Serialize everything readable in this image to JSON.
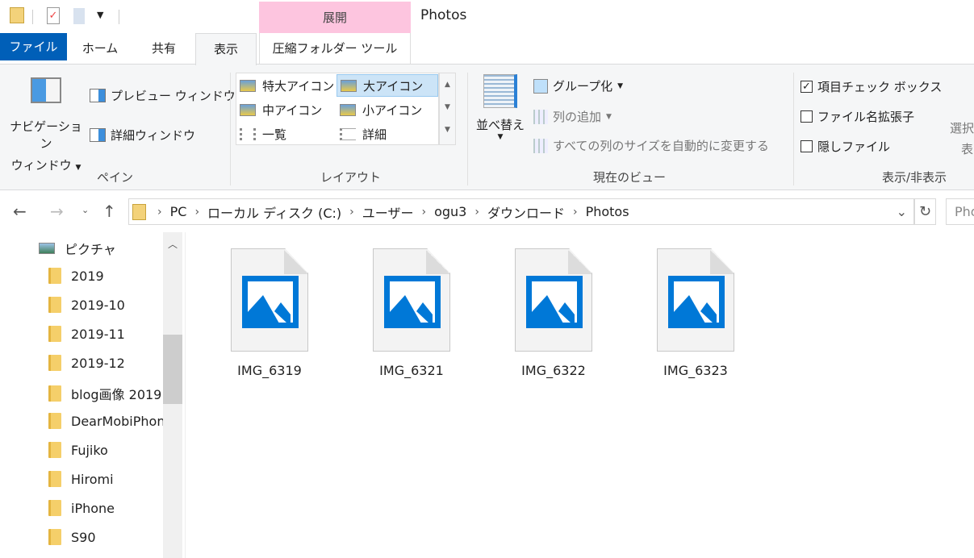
{
  "window": {
    "title": "Photos",
    "contextual_tab": "展開",
    "contextual_color": "#fdc5df"
  },
  "tabs": [
    {
      "label": "ファイル",
      "active_color": "#005fb8"
    },
    {
      "label": "ホーム"
    },
    {
      "label": "共有"
    },
    {
      "label": "表示",
      "selected": true
    },
    {
      "label": "圧縮フォルダー ツール"
    }
  ],
  "ribbon": {
    "pane": {
      "label": "ペイン",
      "nav_pane": "ナビゲーション",
      "nav_pane2": "ウィンドウ",
      "preview": "プレビュー ウィンドウ",
      "details": "詳細ウィンドウ"
    },
    "layout": {
      "label": "レイアウト",
      "items": [
        "特大アイコン",
        "大アイコン",
        "中アイコン",
        "小アイコン",
        "一覧",
        "詳細"
      ],
      "selected": "大アイコン"
    },
    "current_view": {
      "label": "現在のビュー",
      "sort": "並べ替え",
      "group": "グループ化",
      "add_column": "列の追加",
      "autosize": "すべての列のサイズを自動的に変更する"
    },
    "show_hide": {
      "label": "表示/非表示",
      "item_checkbox": "項目チェック ボックス",
      "item_checkbox_checked": true,
      "extensions": "ファイル名拡張子",
      "extensions_checked": false,
      "hidden": "隠しファイル",
      "hidden_checked": false,
      "select": "選択",
      "select2": "表"
    }
  },
  "address": {
    "crumbs": [
      "PC",
      "ローカル ディスク (C:)",
      "ユーザー",
      "ogu3",
      "ダウンロード",
      "Photos"
    ],
    "search_placeholder": "Pho"
  },
  "nav": {
    "root": "ピクチャ",
    "folders": [
      "2019",
      "2019-10",
      "2019-11",
      "2019-12",
      "blog画像 2019",
      "DearMobiPhone",
      "Fujiko",
      "Hiromi",
      "iPhone",
      "S90"
    ]
  },
  "files": [
    "IMG_6319",
    "IMG_6321",
    "IMG_6322",
    "IMG_6323"
  ]
}
